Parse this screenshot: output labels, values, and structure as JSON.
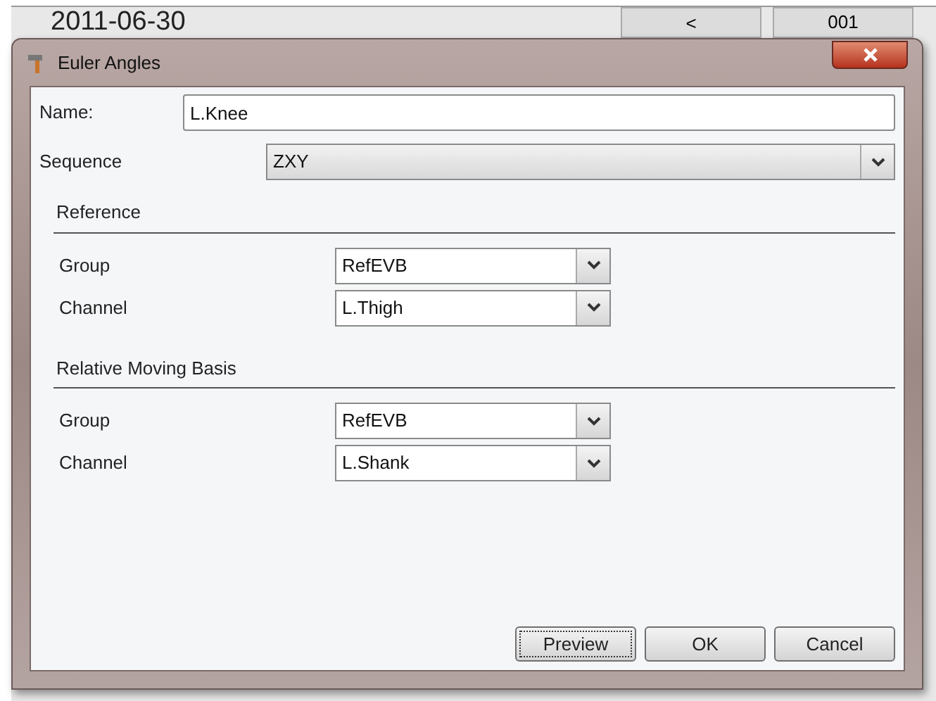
{
  "background_app": {
    "date": "2011-06-30",
    "nav_button": "<",
    "number": "001"
  },
  "window": {
    "title": "Euler Angles"
  },
  "name_field": {
    "label": "Name:",
    "value": "L.Knee"
  },
  "sequence": {
    "label": "Sequence",
    "value": "ZXY"
  },
  "sections": [
    {
      "title": "Reference",
      "rows": [
        {
          "label": "Group",
          "value": "RefEVB"
        },
        {
          "label": "Channel",
          "value": "L.Thigh"
        }
      ]
    },
    {
      "title": "Relative Moving Basis",
      "rows": [
        {
          "label": "Group",
          "value": "RefEVB"
        },
        {
          "label": "Channel",
          "value": "L.Shank"
        }
      ]
    }
  ],
  "buttons": [
    {
      "label": "Preview",
      "focused": true
    },
    {
      "label": "OK",
      "focused": false
    },
    {
      "label": "Cancel",
      "focused": false
    }
  ]
}
